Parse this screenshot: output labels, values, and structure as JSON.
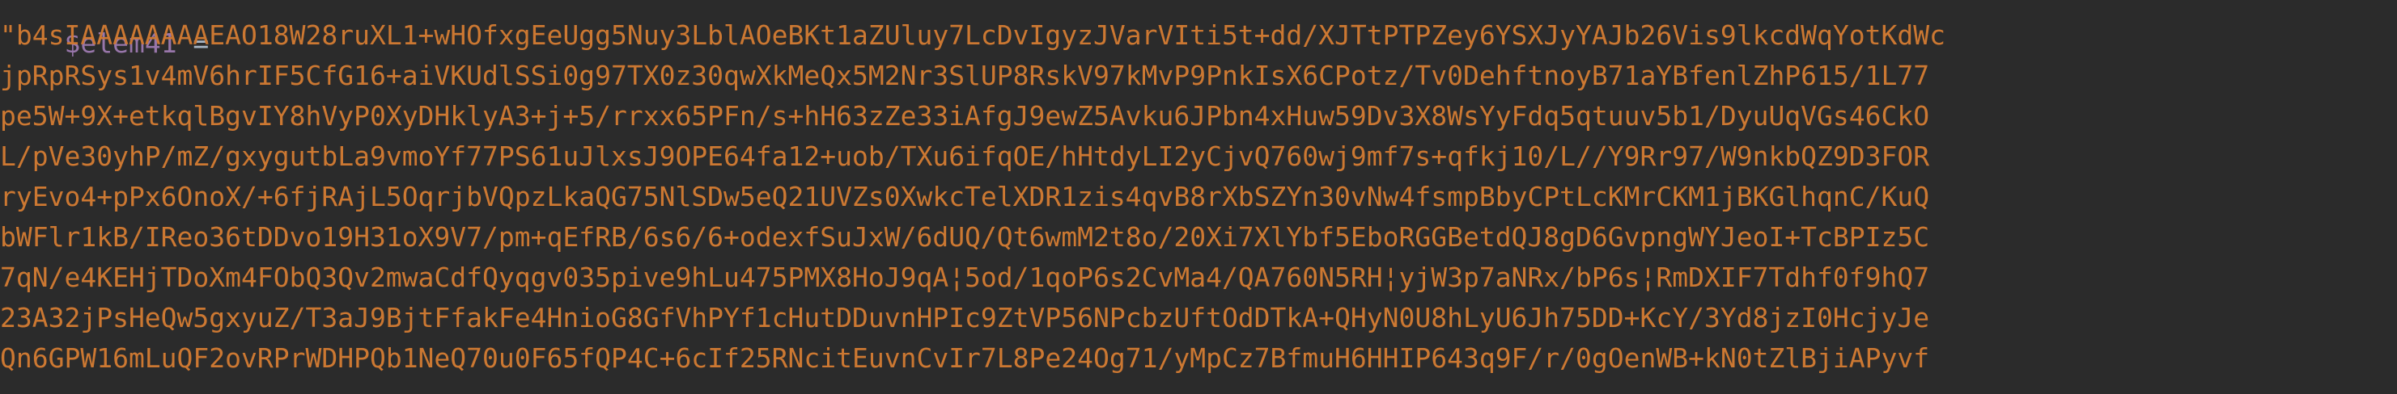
{
  "editor": {
    "variable": "$elem41",
    "operator": " =",
    "lines": [
      "\"b4sIAAAAAAAAEAO18W28ruXL1+wHOfxgEeUgg5Nuy3LblAOeBKt1aZUluy7LcDvIgyzJVarVIti5t+dd/XJTtPTPZey6YSXJyYAJb26Vis9lkcdWqYotKdWc",
      "jpRpRSys1v4mV6hrIF5CfG16+aiVKUdlSSi0g97TX0z30qwXkMeQx5M2Nr3SlUP8RskV97kMvP9PnkIsX6CPotz/Tv0DehftnoyB71aYBfenlZhP615/1L77",
      "pe5W+9X+etkqlBgvIY8hVyP0XyDHklyA3+j+5/rrxx65PFn/s+hH63zZe33iAfgJ9ewZ5Avku6JPbn4xHuw59Dv3X8WsYyFdq5qtuuv5b1/DyuUqVGs46CkO",
      "L/pVe30yhP/mZ/gxygutbLa9vmoYf77PS61uJlxsJ9OPE64fa12+uob/TXu6ifqOE/hHtdyLI2yCjvQ760wj9mf7s+qfkj10/L//Y9Rr97/W9nkbQZ9D3FOR",
      "ryEvo4+pPx6OnoX/+6fjRAjL5OqrjbVQpzLkaQG75NlSDw5eQ21UVZs0XwkcTelXDR1zis4qvB8rXbSZYn30vNw4fsmpBbyCPtLcKMrCKM1jBKGlhqnC/KuQ",
      "bWFlr1kB/IReo36tDDvo19H31oX9V7/pm+qEfRB/6s6/6+odexfSuJxW/6dUQ/Qt6wmM2t8o/20Xi7XlYbf5EboRGGBetdQJ8gD6GvpngWYJeoI+TcBPIz5C",
      "7qN/e4KEHjTDoXm4FObQ3Qv2mwaCdfQyqgv035pive9hLu475PMX8HoJ9qA¦5od/1qoP6s2CvMa4/QA760N5RH¦yjW3p7aNRx/bP6s¦RmDXIF7Tdhf0f9hQ7",
      "23A32jPsHeQw5gxyuZ/T3aJ9BjtFfakFe4HnioG8GfVhPYf1cHutDDuvnHPIc9ZtVP56NPcbzUftOdDTkA+QHyN0U8hLyU6Jh75DD+KcY/3Yd8jzI0HcjyJe",
      "Qn6GPW16mLuQF2ovRPrWDHPQb1NeQ70u0F65fQP4C+6cIf25RNcitEuvnCvIr7L8Pe24Og71/yMpCz7BfmuH6HHIP643q9F/r/0gOenWB+kN0tZlBjiAPyvf"
    ]
  }
}
